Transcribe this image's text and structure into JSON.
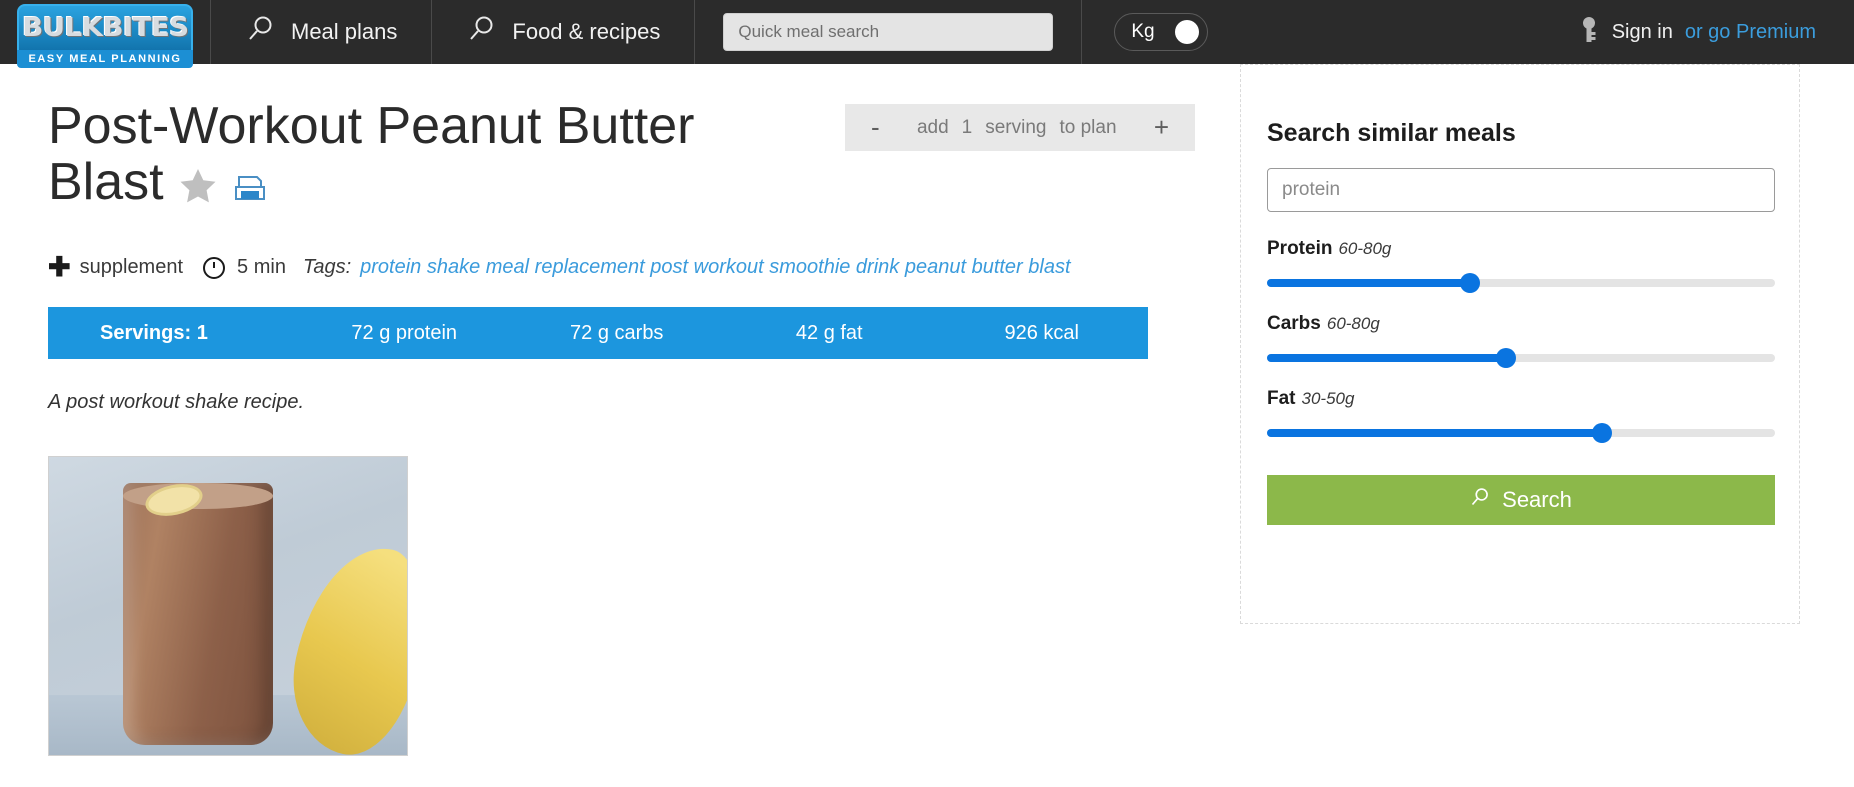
{
  "header": {
    "logo": {
      "name": "BULKBITES",
      "tagline": "EASY MEAL PLANNING"
    },
    "nav": [
      {
        "label": "Meal plans",
        "icon": "search-icon"
      },
      {
        "label": "Food & recipes",
        "icon": "search-icon"
      }
    ],
    "quick_search": {
      "placeholder": "Quick meal search",
      "value": ""
    },
    "unit_toggle": {
      "label": "Kg",
      "state": "on"
    },
    "account": {
      "icon": "key-icon",
      "signin_label": "Sign in",
      "premium_label": "or go Premium"
    }
  },
  "main": {
    "title": "Post-Workout Peanut Butter Blast",
    "favorite_icon": "star-icon",
    "print_icon": "print-icon",
    "stepper": {
      "minus": "-",
      "add_label": "add",
      "quantity": "1",
      "unit_label": "serving",
      "target_label": "to plan",
      "plus": "+"
    },
    "meta": {
      "plus_icon": "plus-icon",
      "category": "supplement",
      "clock_icon": "clock-icon",
      "time": "5 min",
      "tags_label": "Tags:",
      "tags": "protein shake meal replacement post workout smoothie drink peanut butter blast"
    },
    "macros": [
      {
        "label": "Servings: 1"
      },
      {
        "label": "72 g protein"
      },
      {
        "label": "72 g carbs"
      },
      {
        "label": "42 g fat"
      },
      {
        "label": "926 kcal"
      }
    ],
    "description": "A post workout shake recipe.",
    "photo_alt": "chocolate protein shake in a glass with banana"
  },
  "sidebar": {
    "title": "Search similar meals",
    "keyword_input": {
      "placeholder": "protein",
      "value": ""
    },
    "sliders": [
      {
        "label": "Protein",
        "range": "60-80g",
        "percent": 40
      },
      {
        "label": "Carbs",
        "range": "60-80g",
        "percent": 47
      },
      {
        "label": "Fat",
        "range": "30-50g",
        "percent": 66
      }
    ],
    "search_button": {
      "label": "Search",
      "icon": "search-icon"
    }
  },
  "colors": {
    "header_bg": "#2b2b2b",
    "accent_blue": "#1c96de",
    "link_blue": "#3a9bdc",
    "slider_blue": "#0a74e0",
    "button_green": "#8cb84a"
  }
}
